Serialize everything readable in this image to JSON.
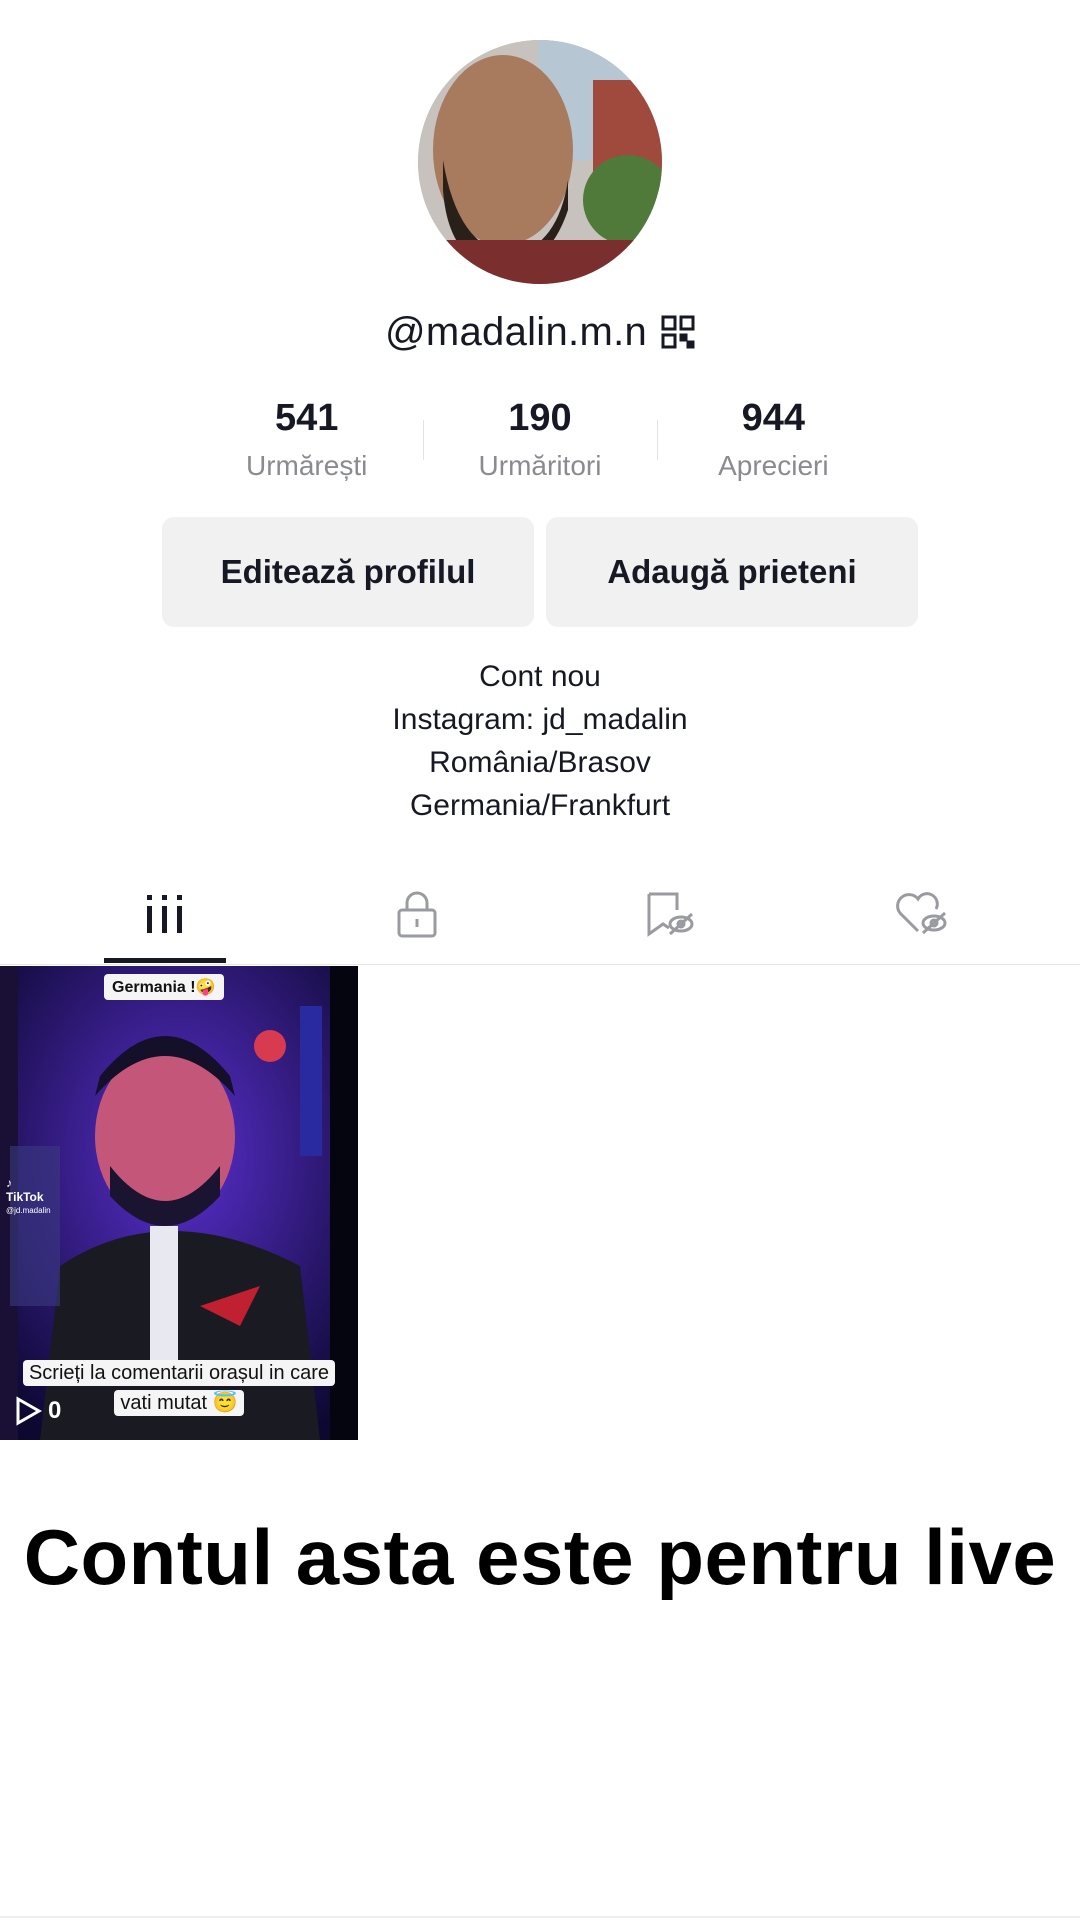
{
  "profile": {
    "username": "@madalin.m.n",
    "qr_icon": "qr-code-icon"
  },
  "stats": [
    {
      "count": "541",
      "label": "Urmărești"
    },
    {
      "count": "190",
      "label": "Urmăritori"
    },
    {
      "count": "944",
      "label": "Aprecieri"
    }
  ],
  "buttons": {
    "edit": "Editează profilul",
    "add_friends": "Adaugă prieteni"
  },
  "bio": [
    "Cont nou",
    "Instagram: jd_madalin",
    "România/Brasov",
    "Germania/Frankfurt"
  ],
  "tabs": [
    {
      "icon": "grid-videos-icon",
      "active": true
    },
    {
      "icon": "lock-icon",
      "active": false
    },
    {
      "icon": "bookmark-hidden-icon",
      "active": false
    },
    {
      "icon": "heart-hidden-icon",
      "active": false
    }
  ],
  "video": {
    "caption_top": "Germania !🤪",
    "caption_bottom": "Scrieți la comentarii orașul in care vati mutat 😇",
    "watermark_brand": "TikTok",
    "watermark_handle": "@jd.madalin",
    "play_count": "0"
  },
  "overlay_text": "Contul asta este pentru live",
  "colors": {
    "text_primary": "#161823",
    "text_secondary": "#8a8b91",
    "button_bg": "#f1f1f2"
  }
}
